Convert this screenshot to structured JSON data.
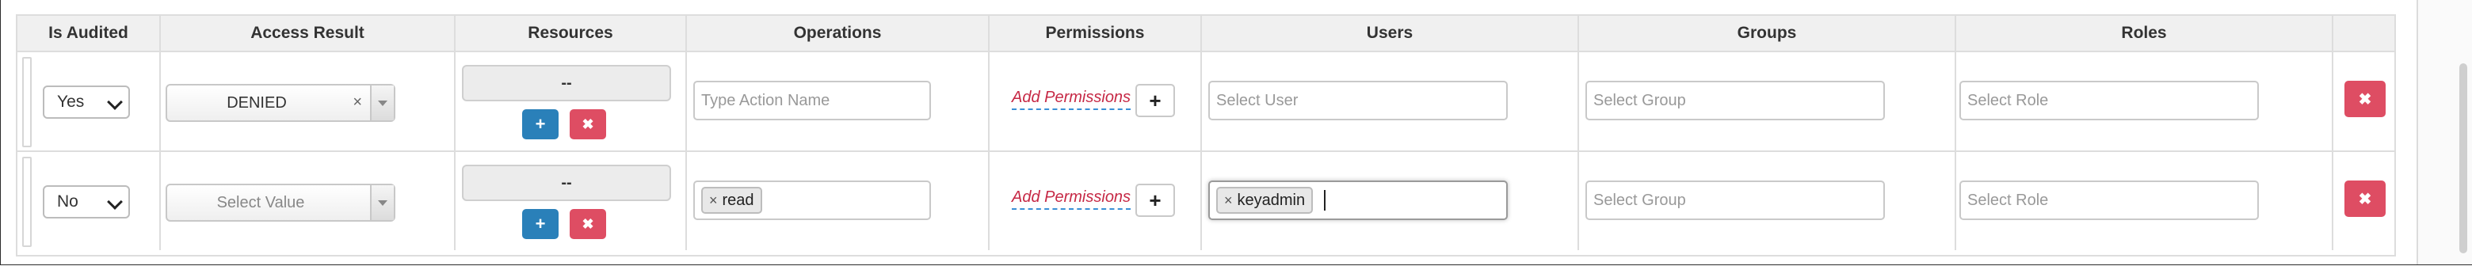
{
  "headers": {
    "is_audited": "Is Audited",
    "access_result": "Access Result",
    "resources": "Resources",
    "operations": "Operations",
    "permissions": "Permissions",
    "users": "Users",
    "groups": "Groups",
    "roles": "Roles"
  },
  "rows": [
    {
      "is_audited": "Yes",
      "access_result": "DENIED",
      "access_result_clear": "×",
      "resources_value": "--",
      "operations_placeholder": "Type Action Name",
      "add_permissions": "Add Permissions",
      "users_placeholder": "Select User",
      "groups_placeholder": "Select Group",
      "roles_placeholder": "Select Role"
    },
    {
      "is_audited": "No",
      "access_result_placeholder": "Select Value",
      "resources_value": "--",
      "operations_tag": "read",
      "add_permissions": "Add Permissions",
      "users_tag": "keyadmin",
      "groups_placeholder": "Select Group",
      "roles_placeholder": "Select Role"
    }
  ],
  "glyphs": {
    "plus": "+",
    "times": "×",
    "remove": "✖"
  },
  "colors": {
    "add_blue": "#2a80b9",
    "delete_red": "#de4d63",
    "permission_link": "#c62845"
  },
  "icons": [
    "plus-icon",
    "close-icon",
    "chevron-down-icon",
    "drag-handle-icon"
  ]
}
